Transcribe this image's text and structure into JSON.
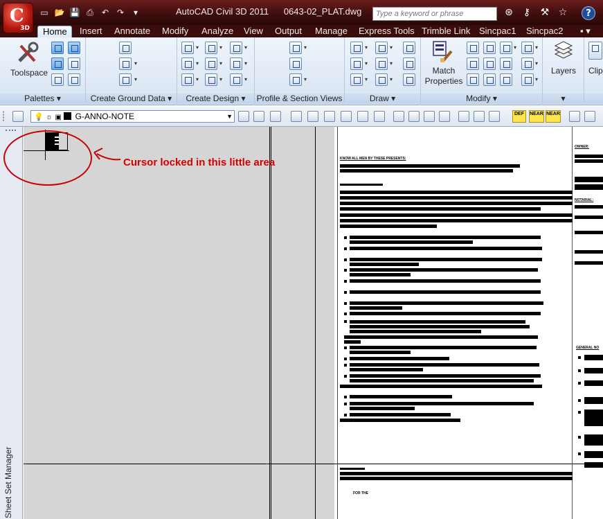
{
  "window": {
    "app_title": "AutoCAD Civil 3D 2011",
    "file_name": "0643-02_PLAT.dwg",
    "app_button": {
      "label": "C",
      "sub": "3D"
    },
    "search_placeholder": "Type a keyword or phrase",
    "help_label": "?"
  },
  "qat_icons": [
    "new-icon",
    "open-icon",
    "save-icon",
    "print-icon",
    "undo-icon",
    "redo-icon",
    "dropdown-icon"
  ],
  "qat_glyphs": [
    "▭",
    "📂",
    "💾",
    "⎙",
    "↶",
    "↷",
    "▾"
  ],
  "title_icons": [
    "binoculars-icon",
    "key-icon",
    "tools-icon",
    "star-icon"
  ],
  "title_glyphs": [
    "⊛",
    "⚷",
    "⚒",
    "☆"
  ],
  "ribbon_tabs": [
    "Home",
    "Insert",
    "Annotate",
    "Modify",
    "Analyze",
    "View",
    "Output",
    "Manage",
    "Express Tools",
    "Trimble Link",
    "Sincpac1",
    "Sincpac2"
  ],
  "active_tab": "Home",
  "ribbon_tab_menu": "▪ ▾",
  "panels": {
    "palettes": {
      "label": "Palettes",
      "big_button": "Toolspace"
    },
    "ground": {
      "label": "Create Ground Data"
    },
    "design": {
      "label": "Create Design"
    },
    "profile": {
      "label": "Profile & Section Views"
    },
    "draw": {
      "label": "Draw"
    },
    "modify": {
      "label": "Modify",
      "big_button": "Match Properties"
    },
    "layers": {
      "big_button": "Layers"
    },
    "clipboard": {
      "big_button": "Clip"
    }
  },
  "layer_toolbar": {
    "current_layer": "G-ANNO-NOTE",
    "snap_buttons": [
      "DEF",
      "NEAR",
      "NEAR"
    ]
  },
  "side_palette": {
    "title": "Sheet Set Manager"
  },
  "drawing_text": {
    "line1": "KNOW ALL MEN BY THESE PRESENTS:",
    "owner": "OWNER:",
    "notary": "NOTARIAL:",
    "general_notes": "GENERAL NO",
    "bottom_small": "FOR THE"
  },
  "annotation": {
    "text": "Cursor locked in this little area",
    "color": "#d40000"
  },
  "colors": {
    "title_bar": "#4a1312",
    "ribbon": "#dce7f4",
    "canvas": "#d5d5d5",
    "annotation": "#c80000"
  }
}
